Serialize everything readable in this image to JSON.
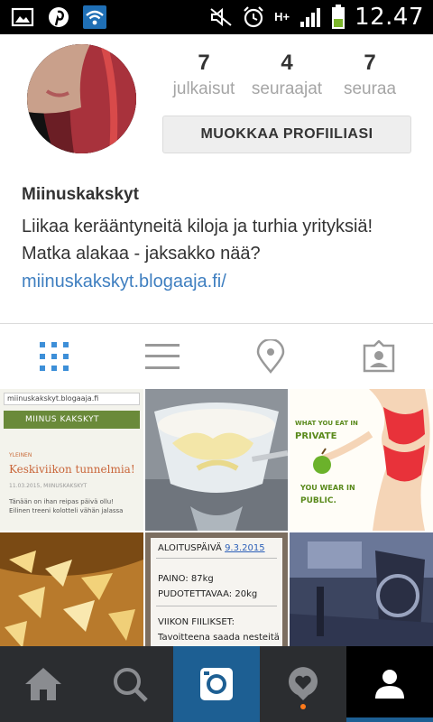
{
  "status_bar": {
    "time": "12.47",
    "network": "H+",
    "left_icons": [
      "gallery-icon",
      "pinterest-icon",
      "wifi-icon"
    ],
    "right_icons": [
      "mute-icon",
      "alarm-icon",
      "network-icon",
      "signal-icon",
      "battery-icon"
    ]
  },
  "profile": {
    "username": "Miinuskakskyt",
    "bio": "Liikaa kerääntyneitä kiloja ja turhia yrityksiä! Matka alakaa - jaksakko nää?",
    "link": "miinuskakskyt.blogaaja.fi/",
    "stats": [
      {
        "value": "7",
        "label": "julkaisut"
      },
      {
        "value": "4",
        "label": "seuraajat"
      },
      {
        "value": "7",
        "label": "seuraa"
      }
    ],
    "edit_button": "MUOKKAA PROFIILIASI"
  },
  "view_tabs": [
    "grid-view-icon",
    "list-view-icon",
    "location-pin-icon",
    "tagged-photos-icon"
  ],
  "posts": [
    {
      "url": "miinuskakskyt.blogaaja.fi",
      "header": "MIINUS KAKSKYT",
      "category": "YLEINEN",
      "title": "Keskiviikon tunnelmia!",
      "date": "11.03.2015, MIINUSKAKSKYT",
      "text": "Tänään on ihan reipas päivä ollu! Eilinen treeni kolotteli vähän jalassa"
    },
    {},
    {
      "line1": "WHAT YOU EAT IN",
      "line2": "PRIVATE",
      "line3": "YOU WEAR IN",
      "line4": "PUBLIC."
    },
    {},
    {
      "start_label": "ALOITUSPÄIVÄ",
      "start_date": "9.3.2015",
      "weight": "PAINO: 87kg",
      "to_lose": "PUDOTETTAVAA: 20kg",
      "week_label": "VIIKON FIILIKSET:",
      "goal": "Tavoitteena saada nesteitä"
    },
    {}
  ],
  "bottom_nav": [
    "home-icon",
    "search-icon",
    "camera-icon",
    "activity-icon",
    "profile-icon"
  ],
  "colors": {
    "link": "#3f7fc0",
    "accent": "#1d5f93",
    "notification": "#ff7a1a",
    "nav_bg": "#2b2d30"
  }
}
